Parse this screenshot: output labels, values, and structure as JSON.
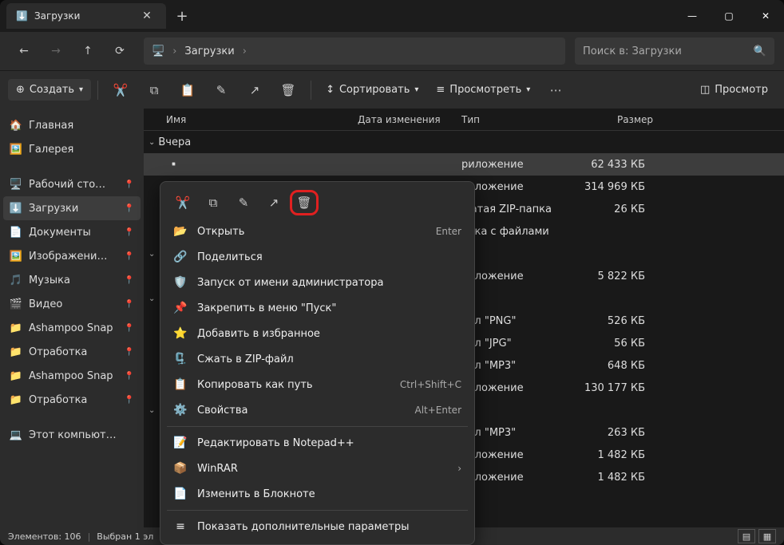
{
  "window": {
    "tab_title": "Загрузки",
    "breadcrumb": "Загрузки",
    "search_placeholder": "Поиск в: Загрузки"
  },
  "toolbar": {
    "create": "Создать",
    "sort": "Сортировать",
    "view": "Просмотреть",
    "details_panel": "Просмотр"
  },
  "sidebar": {
    "items": [
      {
        "icon": "🏠",
        "label": "Главная"
      },
      {
        "icon": "🖼️",
        "label": "Галерея"
      },
      {
        "icon": "🖥️",
        "label": "Рабочий сто…",
        "pinned": true
      },
      {
        "icon": "⬇️",
        "label": "Загрузки",
        "active": true,
        "pinned": true
      },
      {
        "icon": "📄",
        "label": "Документы",
        "pinned": true
      },
      {
        "icon": "🖼️",
        "label": "Изображени…",
        "pinned": true
      },
      {
        "icon": "🎵",
        "label": "Музыка",
        "pinned": true
      },
      {
        "icon": "🎬",
        "label": "Видео",
        "pinned": true
      },
      {
        "icon": "📁",
        "label": "Ashampoo Snap",
        "pinned": true
      },
      {
        "icon": "📁",
        "label": "Отработка",
        "pinned": true
      },
      {
        "icon": "📁",
        "label": "Ashampoo Snap",
        "pinned": true
      },
      {
        "icon": "📁",
        "label": "Отработка",
        "pinned": true
      },
      {
        "icon": "💻",
        "label": "Этот компьют…"
      }
    ]
  },
  "columns": {
    "name": "Имя",
    "date": "Дата изменения",
    "type": "Тип",
    "size": "Размер"
  },
  "groups": [
    {
      "label": "Вчера",
      "rows": [
        {
          "type": "риложение",
          "size": "62 433 КБ",
          "selected": true
        },
        {
          "type": "риложение",
          "size": "314 969 КБ"
        },
        {
          "type": "жатая ZIP-папка",
          "size": "26 КБ"
        },
        {
          "type": "апка с файлами",
          "size": ""
        }
      ]
    },
    {
      "label": "",
      "rows": [
        {
          "type": "риложение",
          "size": "5 822 КБ"
        }
      ]
    },
    {
      "label": "",
      "rows": [
        {
          "type": "айл \"PNG\"",
          "size": "526 КБ"
        },
        {
          "type": "айл \"JPG\"",
          "size": "56 КБ"
        },
        {
          "type": "айл \"MP3\"",
          "size": "648 КБ"
        },
        {
          "type": "риложение",
          "size": "130 177 КБ"
        }
      ]
    },
    {
      "label": "",
      "rows": [
        {
          "type": "айл \"MP3\"",
          "size": "263 КБ"
        },
        {
          "type": "риложение",
          "size": "1 482 КБ"
        },
        {
          "type": "риложение",
          "size": "1 482 КБ"
        }
      ]
    }
  ],
  "context_menu": {
    "items": [
      {
        "icon": "📂",
        "label": "Открыть",
        "kbd": "Enter"
      },
      {
        "icon": "🔗",
        "label": "Поделиться"
      },
      {
        "icon": "🛡️",
        "label": "Запуск от имени администратора"
      },
      {
        "icon": "📌",
        "label": "Закрепить в меню \"Пуск\""
      },
      {
        "icon": "⭐",
        "label": "Добавить в избранное"
      },
      {
        "icon": "🗜️",
        "label": "Сжать в ZIP-файл"
      },
      {
        "icon": "📋",
        "label": "Копировать как путь",
        "kbd": "Ctrl+Shift+C"
      },
      {
        "icon": "⚙️",
        "label": "Свойства",
        "kbd": "Alt+Enter"
      },
      {
        "sep": true
      },
      {
        "icon": "📝",
        "label": "Редактировать в Notepad++"
      },
      {
        "icon": "📦",
        "label": "WinRAR",
        "submenu": true
      },
      {
        "icon": "📄",
        "label": "Изменить в Блокноте"
      },
      {
        "sep": true
      },
      {
        "icon": "≡",
        "label": "Показать дополнительные параметры"
      }
    ]
  },
  "status": {
    "count": "Элементов: 106",
    "selected": "Выбран 1 эл"
  }
}
